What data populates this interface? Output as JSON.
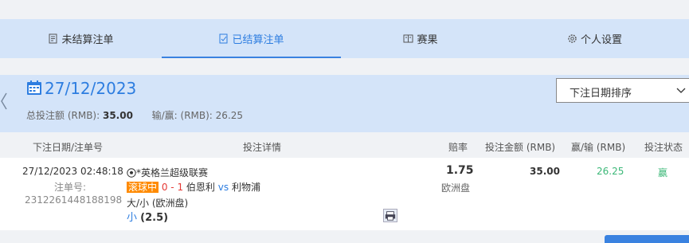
{
  "tabs": [
    {
      "label": "未结算注单",
      "icon": "document-icon"
    },
    {
      "label": "已结算注单",
      "icon": "document-check-icon"
    },
    {
      "label": "赛果",
      "icon": "results-icon"
    },
    {
      "label": "个人设置",
      "icon": "gear-icon"
    }
  ],
  "active_tab_index": 1,
  "date_panel": {
    "date": "27/12/2023",
    "total_label": "总投注额 (RMB):",
    "total_value": "35.00",
    "winloss_label": "输/赢: (RMB):",
    "winloss_value": "26.25"
  },
  "sort": {
    "selected": "下注日期排序"
  },
  "table": {
    "headers": [
      "下注日期/注单号",
      "投注详情",
      "赔率",
      "投注金额 (RMB)",
      "赢/输 (RMB)",
      "投注状态"
    ],
    "row": {
      "datetime": "27/12/2023 02:48:18",
      "ticket_label": "注单号:",
      "ticket_no": "2312261448188198",
      "league": "*英格兰超级联赛",
      "live_badge": "滚球中",
      "score": "0 - 1",
      "home": "伯恩利",
      "vs": "vs",
      "away": "利物浦",
      "market": "大/小 (欧洲盘)",
      "pick": "小",
      "handicap": "(2.5)",
      "odds": "1.75",
      "odds_type": "欧洲盘",
      "stake": "35.00",
      "winloss": "26.25",
      "status": "赢"
    }
  },
  "colors": {
    "accent": "#2d7de0",
    "panel": "#d4e4f9",
    "live": "#ff8a00",
    "win": "#3cb878",
    "score": "#e53935"
  }
}
